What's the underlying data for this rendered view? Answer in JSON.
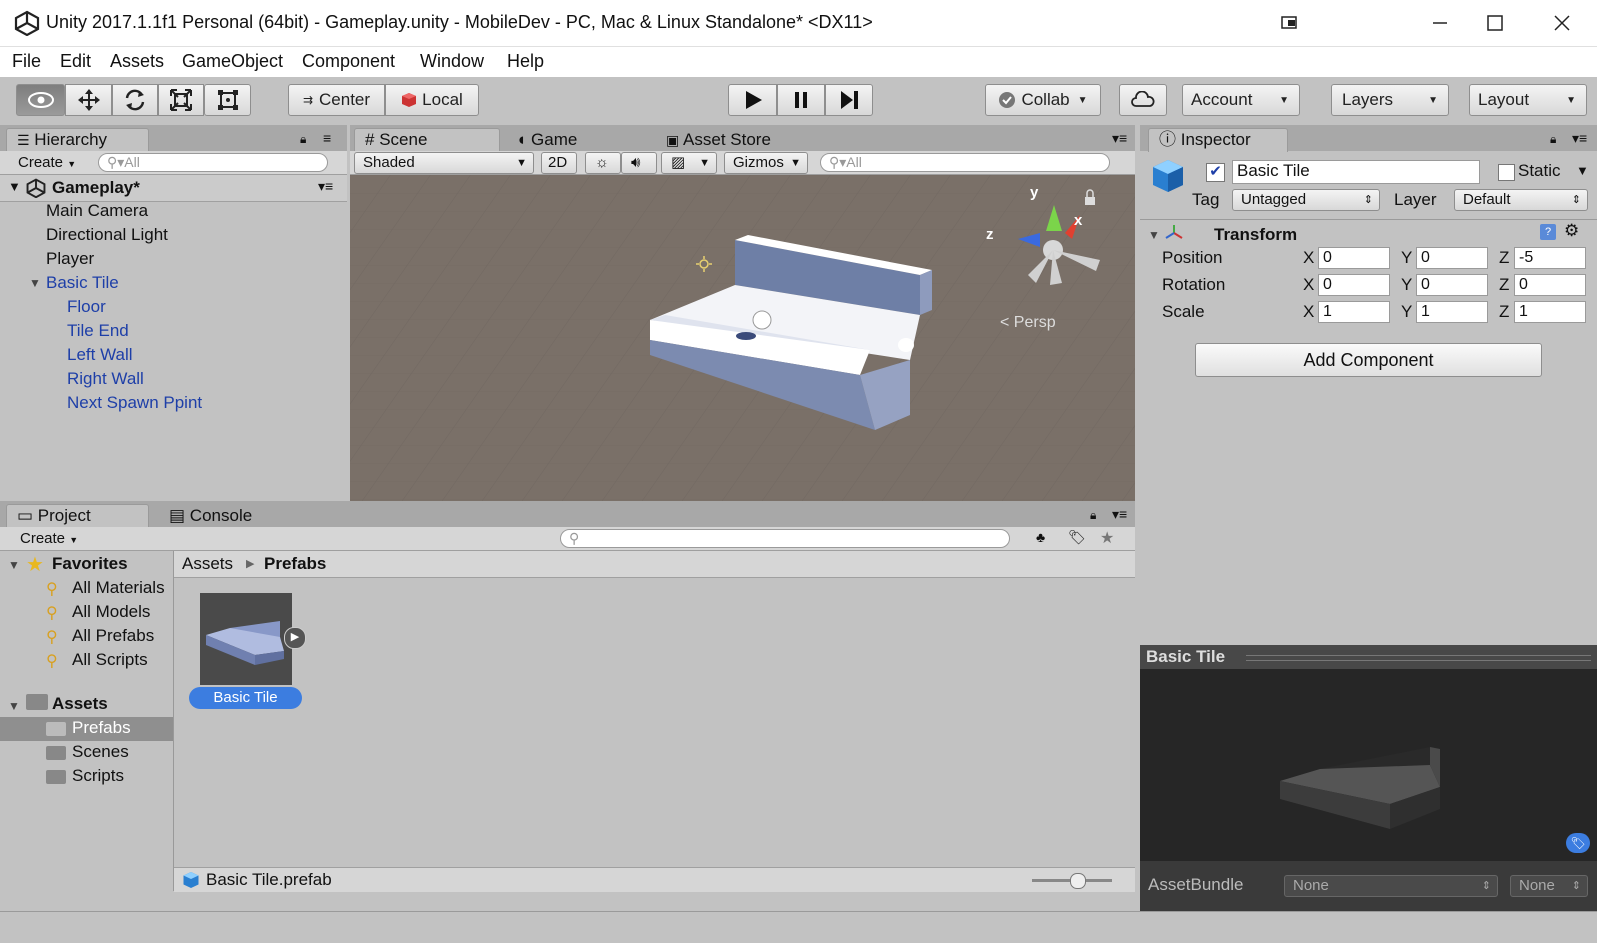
{
  "window": {
    "title": "Unity 2017.1.1f1 Personal (64bit) - Gameplay.unity - MobileDev - PC, Mac & Linux Standalone* <DX11>"
  },
  "menu": [
    "File",
    "Edit",
    "Assets",
    "GameObject",
    "Component",
    "Window",
    "Help"
  ],
  "toolbar": {
    "center_label": "Center",
    "local_label": "Local",
    "collab_label": "Collab",
    "account_label": "Account",
    "layers_label": "Layers",
    "layout_label": "Layout"
  },
  "hierarchy": {
    "tab": "Hierarchy",
    "create": "Create",
    "search_placeholder": "All",
    "scene_name": "Gameplay*",
    "items": [
      "Main Camera",
      "Directional Light",
      "Player",
      "Basic Tile"
    ],
    "children": [
      "Floor",
      "Tile End",
      "Left Wall",
      "Right Wall",
      "Next Spawn Ppint"
    ]
  },
  "scene": {
    "tabs": [
      "Scene",
      "Game",
      "Asset Store"
    ],
    "shading": "Shaded",
    "mode_2d": "2D",
    "gizmos": "Gizmos",
    "search_placeholder": "All",
    "persp": "Persp",
    "axis_y": "y",
    "axis_x": "x",
    "axis_z": "z",
    "background_color": "#7a7068"
  },
  "inspector": {
    "tab": "Inspector",
    "object_name": "Basic Tile",
    "static_label": "Static",
    "tag_label": "Tag",
    "tag_value": "Untagged",
    "layer_label": "Layer",
    "layer_value": "Default",
    "transform_label": "Transform",
    "rows": [
      {
        "label": "Position",
        "x": "0",
        "y": "0",
        "z": "-5"
      },
      {
        "label": "Rotation",
        "x": "0",
        "y": "0",
        "z": "0"
      },
      {
        "label": "Scale",
        "x": "1",
        "y": "1",
        "z": "1"
      }
    ],
    "axis_labels": [
      "X",
      "Y",
      "Z"
    ],
    "add_component": "Add Component",
    "preview_title": "Basic Tile",
    "assetbundle_label": "AssetBundle",
    "assetbundle_value": "None",
    "assetbundle_variant": "None"
  },
  "project": {
    "tabs": [
      "Project",
      "Console"
    ],
    "create": "Create",
    "favorites_label": "Favorites",
    "favorites": [
      "All Materials",
      "All Models",
      "All Prefabs",
      "All Scripts"
    ],
    "assets_label": "Assets",
    "folders": [
      "Prefabs",
      "Scenes",
      "Scripts"
    ],
    "breadcrumb_root": "Assets",
    "breadcrumb_current": "Prefabs",
    "asset_name": "Basic Tile",
    "footer_file": "Basic Tile.prefab",
    "accent": "#3c7de0"
  }
}
